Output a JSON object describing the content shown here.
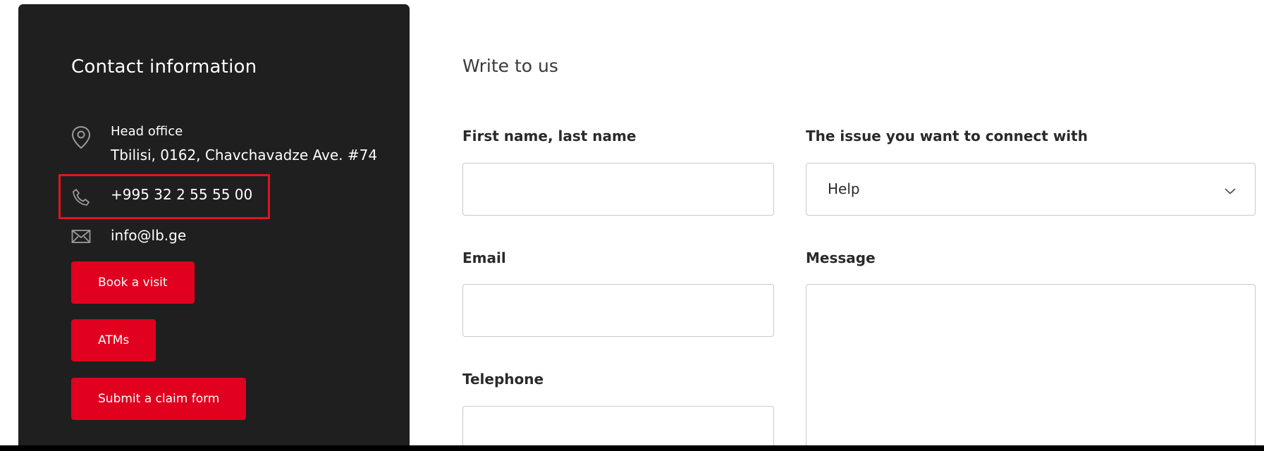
{
  "contact": {
    "title": "Contact information",
    "office_label": "Head office",
    "office_address": "Tbilisi, 0162, Chavchavadze Ave. #74",
    "phone": "+995 32 2 55 55 00",
    "email": "info@lb.ge",
    "buttons": {
      "book_visit": "Book a visit",
      "atms": "ATMs",
      "claim_form": "Submit a claim form"
    }
  },
  "form": {
    "title": "Write to us",
    "name_label": "First name, last name",
    "name_value": "",
    "issue_label": "The issue you want to connect with",
    "issue_selected": "Help",
    "email_label": "Email",
    "email_value": "",
    "message_label": "Message",
    "message_value": "",
    "telephone_label": "Telephone",
    "telephone_value": ""
  },
  "icons": {
    "location": "location-pin-icon",
    "phone": "phone-icon",
    "email": "envelope-icon",
    "dropdown": "chevron-down-icon"
  },
  "colors": {
    "panel_bg": "#1f1f1f",
    "accent_red": "#e1001e",
    "highlight": "#e0141e"
  }
}
